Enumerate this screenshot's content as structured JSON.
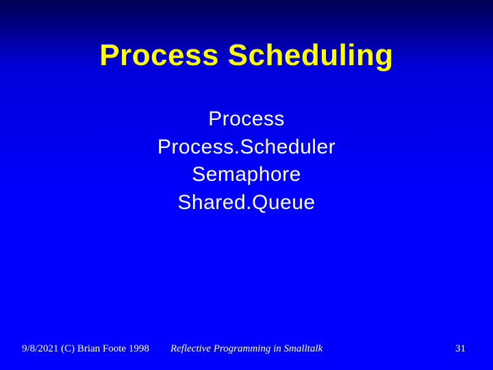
{
  "title": "Process Scheduling",
  "body": {
    "items": [
      "Process",
      "Process.Scheduler",
      "Semaphore",
      "Shared.Queue"
    ]
  },
  "footer": {
    "left": "9/8/2021 (C) Brian Foote 1998",
    "center": "Reflective Programming in Smalltalk",
    "page": "31"
  }
}
